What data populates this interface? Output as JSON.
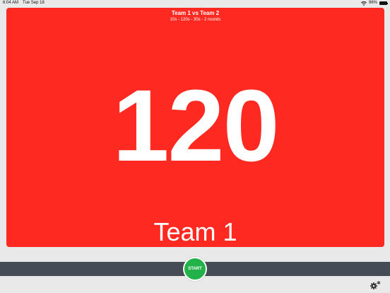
{
  "status_bar": {
    "time": "6:04 AM",
    "date": "Tue Sep 18",
    "battery": "96%",
    "battery_level": 0.96
  },
  "match": {
    "title": "Team 1 vs Team 2",
    "subtitle": "10s - 120s - 30s - 2 rounds"
  },
  "timer": {
    "value": "120",
    "team": "Team 1",
    "panel_color": "#fe2a22"
  },
  "controls": {
    "start_label": "START",
    "start_color": "#23b14a",
    "strip_color": "#454c55"
  },
  "icons": {
    "wifi": "wifi-icon",
    "battery": "battery-icon",
    "settings": "gear-icon"
  }
}
